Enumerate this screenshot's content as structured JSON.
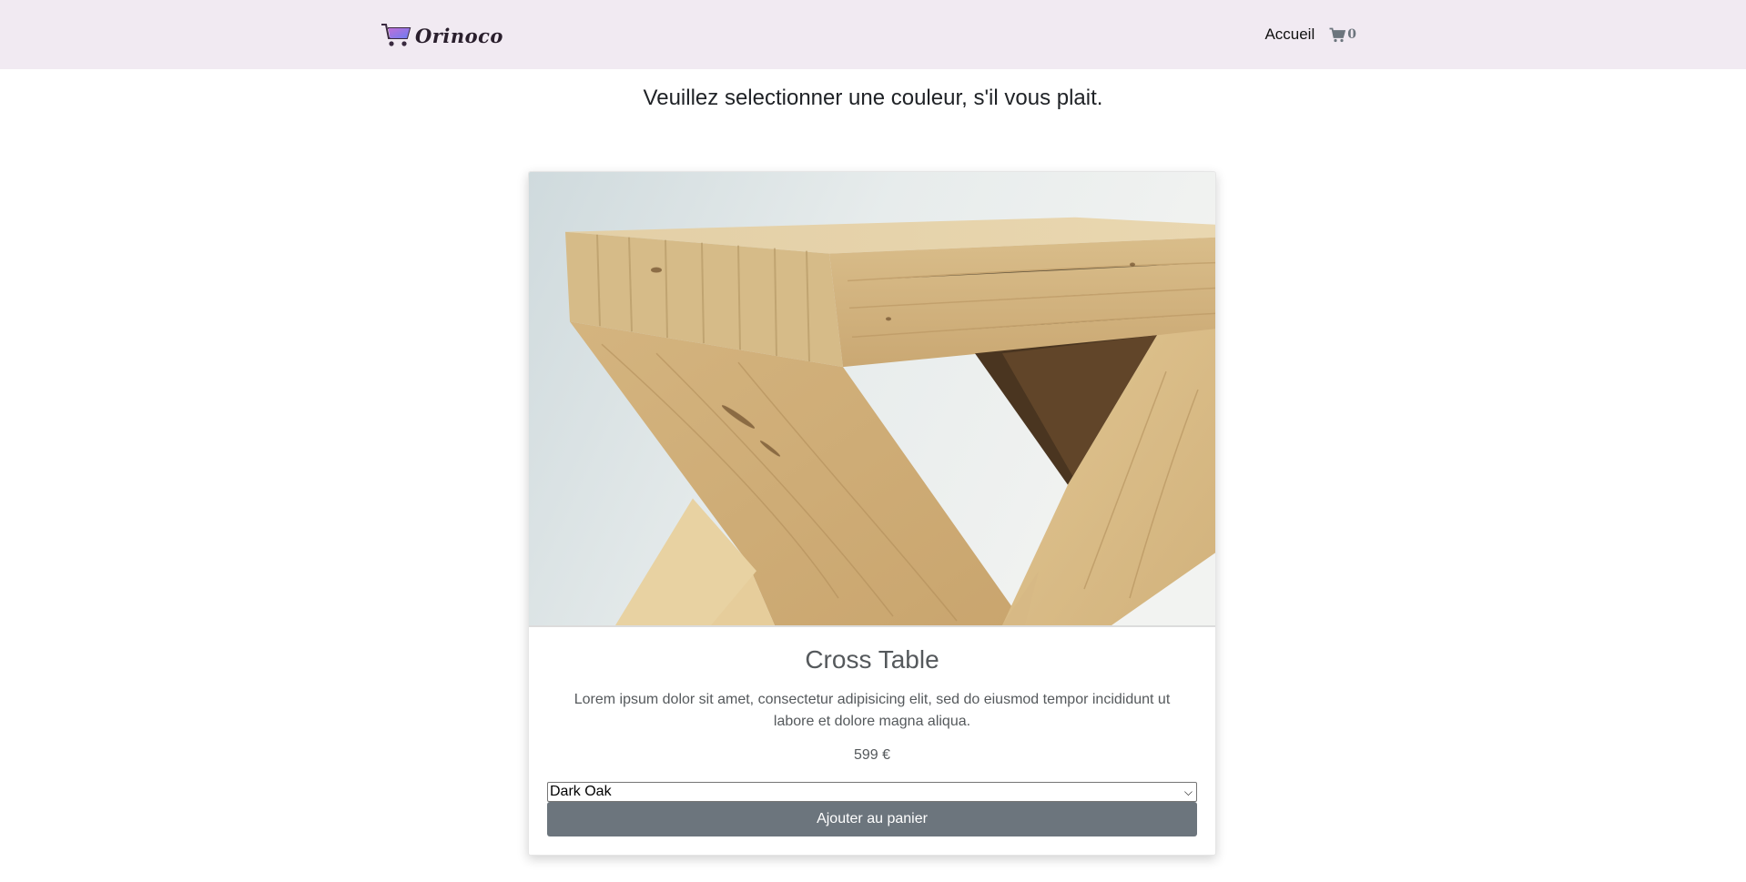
{
  "navbar": {
    "brand_name": "Orinoco",
    "brand_icon": "shopping-cart-logo",
    "links": {
      "home_label": "Accueil"
    },
    "cart": {
      "icon": "cart-icon",
      "count": "0"
    }
  },
  "message": "Veuillez selectionner une couleur, s'il vous plait.",
  "product": {
    "image_alt": "wooden cross table",
    "name": "Cross Table",
    "description": "Lorem ipsum dolor sit amet, consectetur adipisicing elit, sed do eiusmod tempor incididunt ut labore et dolore magna aliqua.",
    "price": "599 €",
    "color_select": {
      "selected": "Dark Oak"
    },
    "add_button_label": "Ajouter au panier"
  },
  "colors": {
    "navbar_bg": "#f1eaf2",
    "button_bg": "#6c757d",
    "brand_gradient_start": "#b86ad6",
    "brand_gradient_end": "#6a7cf0"
  }
}
